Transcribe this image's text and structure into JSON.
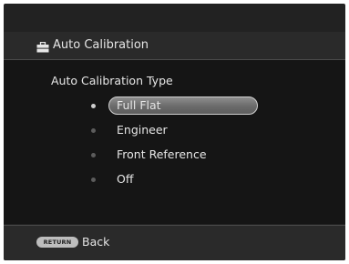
{
  "header": {
    "icon": "toolbox-icon",
    "title": "Auto Calibration"
  },
  "section": {
    "label": "Auto Calibration Type"
  },
  "options": [
    {
      "label": "Full Flat",
      "selected": true
    },
    {
      "label": "Engineer",
      "selected": false
    },
    {
      "label": "Front Reference",
      "selected": false
    },
    {
      "label": "Off",
      "selected": false
    }
  ],
  "footer": {
    "return_key_label": "RETURN",
    "back_label": "Back"
  },
  "colors": {
    "background": "#151515",
    "bar": "#2a2a2a",
    "text": "#e6e6e6",
    "highlight": "#7a7a7a"
  }
}
